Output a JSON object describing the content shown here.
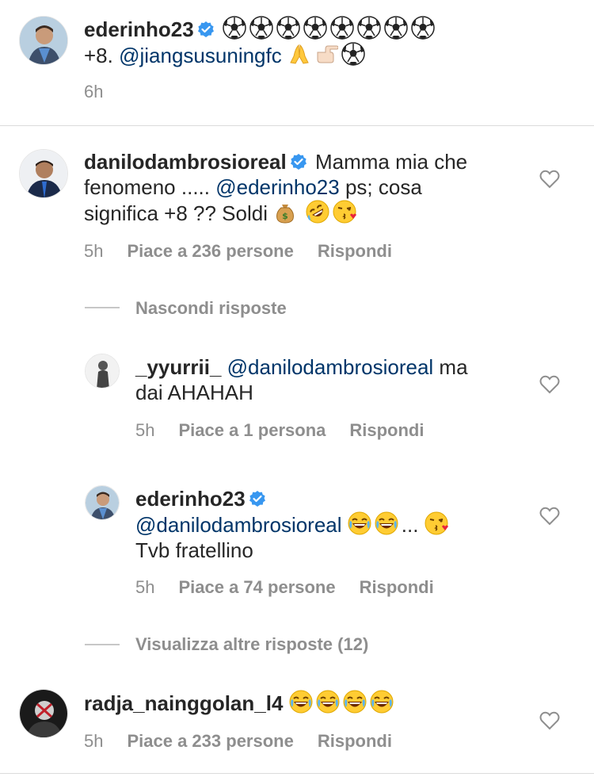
{
  "post": {
    "username": "ederinho23",
    "caption_tail": "+8.",
    "mention": "@jiangsusuningfc",
    "time": "6h"
  },
  "comments": [
    {
      "username": "danilodambrosioreal",
      "text_part1": "Mamma mia che",
      "text_part2": "fenomeno .....",
      "mention": "@ederinho23",
      "text_part3": " ps; cosa",
      "text_part4": "significa +8 ?? Soldi",
      "time": "5h",
      "likes": "Piace a 236 persone",
      "reply": "Rispondi"
    }
  ],
  "thread": {
    "hide_label": "Nascondi risposte",
    "more_label": "Visualizza altre risposte (12)"
  },
  "replies": [
    {
      "username": "_yyurrii_",
      "mention": "@danilodambrosioreal",
      "text_a": " ma",
      "text_b": "dai AHAHAH",
      "time": "5h",
      "likes": "Piace a 1 persona",
      "reply": "Rispondi"
    },
    {
      "username": "ederinho23",
      "mention": "@danilodambrosioreal",
      "text_a": "...",
      "text_b": "Tvb fratellino",
      "time": "5h",
      "likes": "Piace a 74 persone",
      "reply": "Rispondi"
    }
  ],
  "last_comment": {
    "username": "radja_nainggolan_l4",
    "time": "5h",
    "likes": "Piace a 233 persone",
    "reply": "Rispondi"
  },
  "colors": {
    "mention": "#003569",
    "verified": "#3897f0",
    "meta": "#8e8e8e"
  }
}
